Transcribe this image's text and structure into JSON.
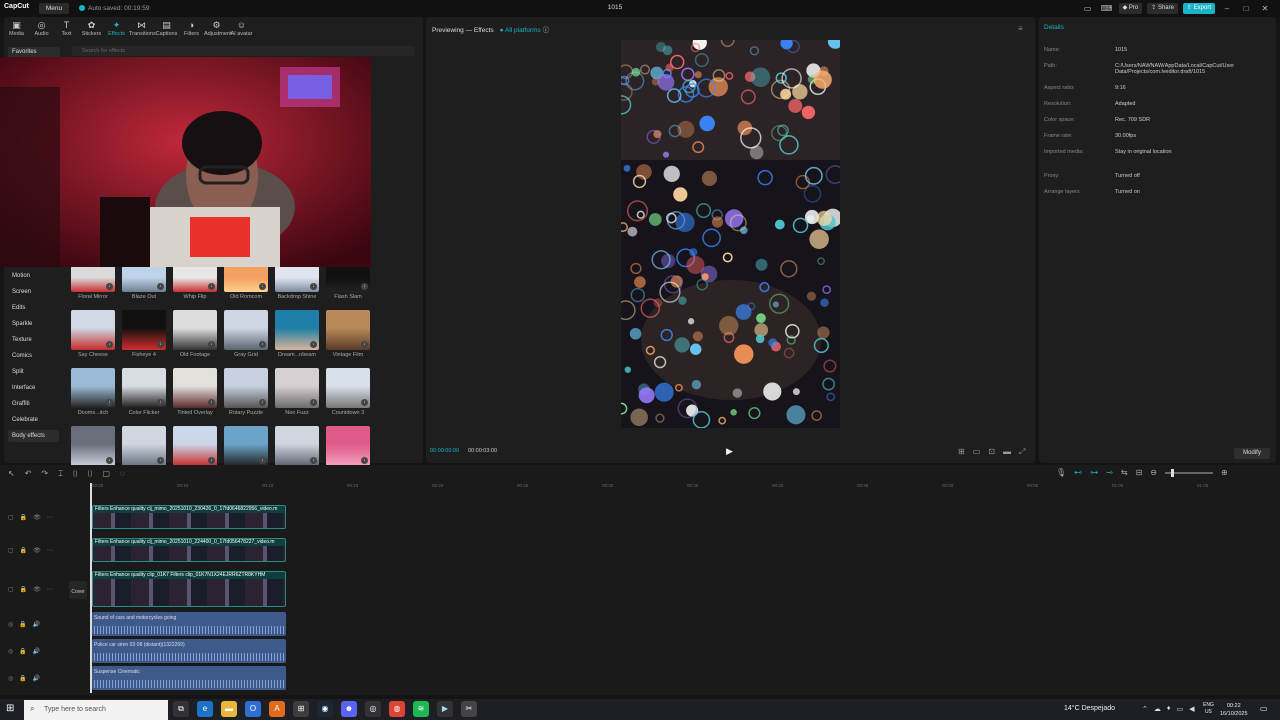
{
  "titlebar": {
    "app_name": "CapCut",
    "menu_label": "Menu",
    "autosave": "Auto saved: 00:19:59",
    "project_title": "1015",
    "pro_label": "Pro",
    "share_label": "Share",
    "export_label": "Export"
  },
  "toolbar": [
    {
      "label": "Media",
      "icon": "media-icon",
      "glyph": "▣"
    },
    {
      "label": "Audio",
      "icon": "audio-icon",
      "glyph": "◎"
    },
    {
      "label": "Text",
      "icon": "text-icon",
      "glyph": "T"
    },
    {
      "label": "Stickers",
      "icon": "sticker-icon",
      "glyph": "✿"
    },
    {
      "label": "Effects",
      "icon": "effects-icon",
      "glyph": "✦"
    },
    {
      "label": "Transitions",
      "icon": "transitions-icon",
      "glyph": "⋈"
    },
    {
      "label": "Captions",
      "icon": "captions-icon",
      "glyph": "▤"
    },
    {
      "label": "Filters",
      "icon": "filters-icon",
      "glyph": "◑"
    },
    {
      "label": "Adjustment",
      "icon": "adjustment-icon",
      "glyph": "⚙"
    },
    {
      "label": "AI avatar",
      "icon": "ai-avatar-icon",
      "glyph": "☺"
    }
  ],
  "active_tool": "Effects",
  "favorites_label": "Favorites",
  "search_placeholder": "Search for effects",
  "categories": [
    "Motion",
    "Screen",
    "Edits",
    "Sparkle",
    "Texture",
    "Comics",
    "Split",
    "Interface",
    "Graffiti",
    "Celebrate",
    "Body effects"
  ],
  "effects": [
    "Floral Mirror",
    "Blaze Out",
    "Whip Flip",
    "Old Romcom",
    "Backdrop Shine",
    "Flash Slam",
    "Say Cheese",
    "Fisheye 4",
    "Old Footage",
    "Gray Grid",
    "Dream...nbeam",
    "Vintage Film",
    "Dooms...itch",
    "Color Flicker",
    "Tinted Overlay",
    "Rotary Puzzle",
    "Neo Fuzz",
    "Countdown 3",
    "",
    "",
    "",
    "",
    "",
    ""
  ],
  "preview": {
    "title": "Previewing — Effects",
    "platform": "All platforms",
    "current_time": "00:00:00:00",
    "total_time": "00:00:03:00"
  },
  "details": {
    "title": "Details",
    "rows": [
      {
        "label": "Name:",
        "value": "1015"
      },
      {
        "label": "Path:",
        "value": "C:/Users/NAWNAW/AppData/Local/CapCut/User Data/Projects/com.lveditor.draft/1015"
      },
      {
        "label": "Aspect ratio:",
        "value": "9:16"
      },
      {
        "label": "Resolution:",
        "value": "Adapted"
      },
      {
        "label": "Color space:",
        "value": "Rec. 709 SDR"
      },
      {
        "label": "Frame rate:",
        "value": "30.00fps"
      },
      {
        "label": "Imported media:",
        "value": "Stay in original location"
      },
      {
        "label": "Proxy:",
        "value": "Turned off"
      },
      {
        "label": "Arrange layers",
        "value": "Turned on"
      }
    ],
    "modify_label": "Modify"
  },
  "ruler": [
    "00:00",
    "00:10",
    "00:10",
    "00:15",
    "00:20",
    "00:25",
    "00:30",
    "00:35",
    "00:40",
    "00:45",
    "00:50",
    "00:55",
    "01:00",
    "01:05"
  ],
  "tracks": {
    "video": [
      {
        "label": "Filters   Enhance quality   clj_mimo_20251010_230426_0_17fd0646822956_video.m"
      },
      {
        "label": "Filters   Enhance quality   clj_mimo_20251010_224400_0_17fd056478227_video.m"
      },
      {
        "label": "Filters   Enhance quality   clip_01K7   Filters   clip_01K7N1X24EJRR6ZTR8KYHM"
      }
    ],
    "audio": [
      {
        "label": "Sound of cars and motorcycles going"
      },
      {
        "label": "Police car siren 02-08 (distant)(1322269)"
      },
      {
        "label": "Suspense Cinematic"
      }
    ],
    "cover_label": "Cover"
  },
  "taskbar": {
    "search_placeholder": "Type here to search",
    "weather": "14°C  Despejado",
    "lang": "ENG",
    "region": "US",
    "time": "00:22",
    "date": "16/10/2025"
  }
}
